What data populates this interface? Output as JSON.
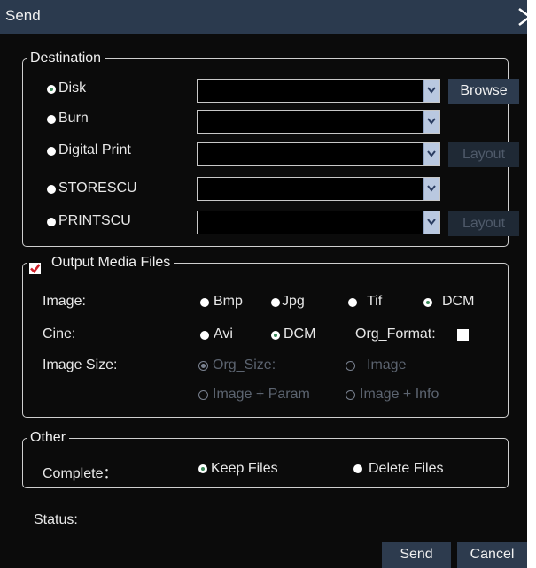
{
  "title": "Send",
  "destination": {
    "legend": "Destination",
    "items": [
      {
        "label": "Disk",
        "value": "",
        "selected": true
      },
      {
        "label": "Burn",
        "value": ""
      },
      {
        "label": "Digital Print",
        "value": ""
      },
      {
        "label": "STORESCU",
        "value": ""
      },
      {
        "label": "PRINTSCU",
        "value": ""
      }
    ],
    "browse_label": "Browse",
    "layout_label": "Layout"
  },
  "output": {
    "legend": "Output Media Files",
    "checked": true,
    "image_label": "Image:",
    "image_options": [
      "Bmp",
      "Jpg",
      "Tif",
      "DCM"
    ],
    "image_selected": "DCM",
    "cine_label": "Cine:",
    "cine_options": [
      "Avi",
      "DCM"
    ],
    "cine_selected": "DCM",
    "org_format_label": "Org_Format:",
    "org_format_checked": false,
    "size_label": "Image Size:",
    "size_options": [
      "Org_Size:",
      "Image",
      "Image + Param",
      "Image + Info"
    ],
    "size_selected": "Org_Size:"
  },
  "other": {
    "legend": "Other",
    "complete_label": "Complete：",
    "options": [
      "Keep Files",
      "Delete Files"
    ],
    "selected": "Keep Files"
  },
  "status_label": "Status:",
  "send_label": "Send",
  "cancel_label": "Cancel",
  "colors": {
    "titlebar": "#2b3a4e",
    "background": "#0b0b0b",
    "button": "#2d3b4e",
    "radio_selected_dot": "#3a8a5a",
    "checkbox_mark": "#d0202a"
  }
}
